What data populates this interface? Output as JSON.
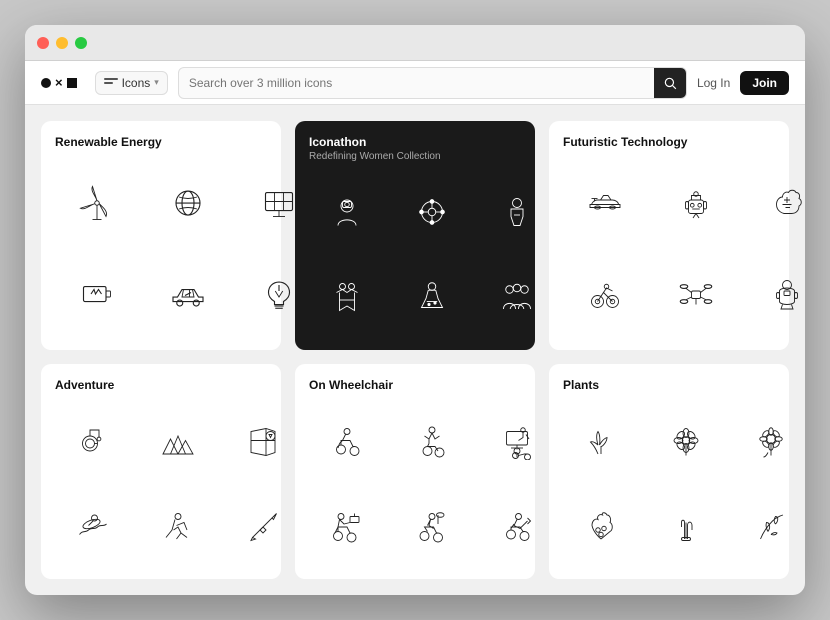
{
  "window": {
    "title": "Noun Project"
  },
  "navbar": {
    "icons_label": "Icons",
    "search_placeholder": "Search over 3 million icons",
    "login_label": "Log In",
    "join_label": "Join"
  },
  "cards": [
    {
      "id": "renewable-energy",
      "title": "Renewable Energy",
      "subtitle": "",
      "dark": false
    },
    {
      "id": "iconathon",
      "title": "Iconathon",
      "subtitle": "Redefining Women Collection",
      "dark": true
    },
    {
      "id": "futuristic-technology",
      "title": "Futuristic Technology",
      "subtitle": "",
      "dark": false
    },
    {
      "id": "adventure",
      "title": "Adventure",
      "subtitle": "",
      "dark": false
    },
    {
      "id": "on-wheelchair",
      "title": "On Wheelchair",
      "subtitle": "",
      "dark": false
    },
    {
      "id": "plants",
      "title": "Plants",
      "subtitle": "",
      "dark": false
    }
  ]
}
